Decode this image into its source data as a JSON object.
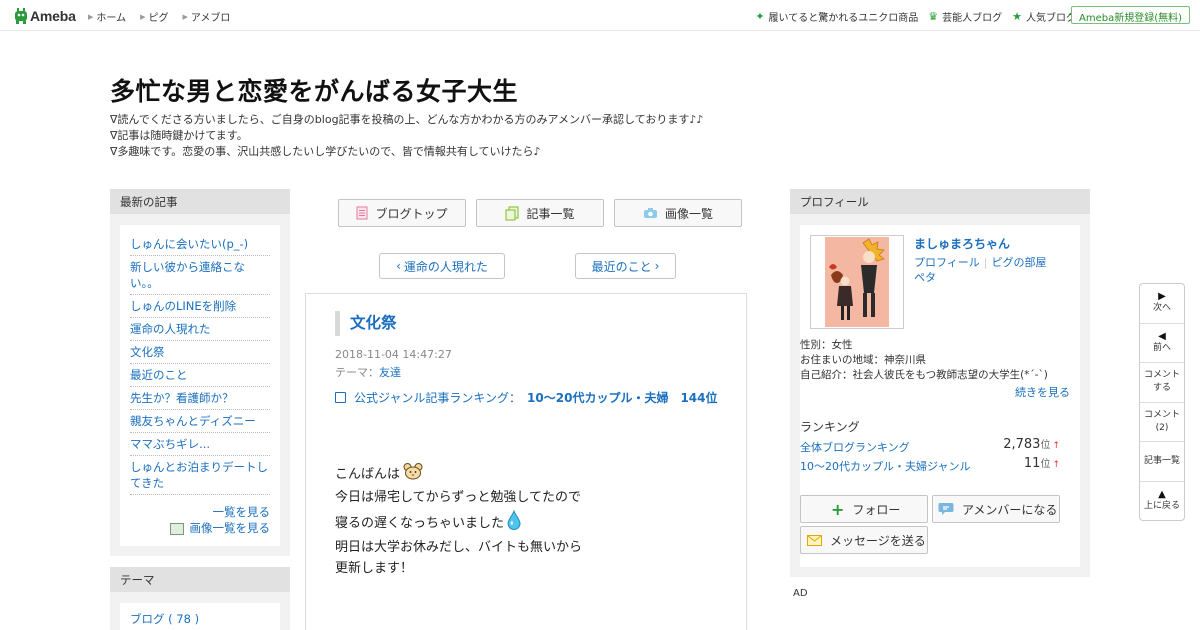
{
  "topbar": {
    "logo": "Ameba",
    "nav": [
      "ホーム",
      "ピグ",
      "アメブロ"
    ],
    "right_links": [
      {
        "icon": "sparkle-icon",
        "label": "履いてると驚かれるユニクロ商品"
      },
      {
        "icon": "crown-icon",
        "label": "芸能人ブログ"
      },
      {
        "icon": "star-icon",
        "label": "人気ブログ"
      }
    ],
    "signup": "Ameba新規登録(無料)"
  },
  "header": {
    "title": "多忙な男と恋愛をがんばる女子大生",
    "desc": [
      "∇読んでくださる方いましたら、ご自身のblog記事を投稿の上、どんな方かわかる方のみアメンバー承認しております♪♪",
      "∇記事は随時鍵かけてます。",
      "∇多趣味です。恋愛の事、沢山共感したいし学びたいので、皆で情報共有していけたら♪"
    ]
  },
  "latest": {
    "heading": "最新の記事",
    "items": [
      "しゅんに会いたい(p_-)",
      "新しい彼から連絡こない。。",
      "しゅんのLINEを削除",
      "運命の人現れた",
      "文化祭",
      "最近のこと",
      "先生か？看護師か？",
      "親友ちゃんとディズニー",
      "ママぶちギレ...",
      "しゅんとお泊まりデートしてきた"
    ],
    "more_list": "一覧を見る",
    "more_images": "画像一覧を見る"
  },
  "theme_box": {
    "heading": "テーマ",
    "items": [
      "ブログ ( 78 )"
    ]
  },
  "center_nav": {
    "blog_top": "ブログトップ",
    "article_list": "記事一覧",
    "image_list": "画像一覧",
    "prev": "運命の人現れた",
    "next": "最近のこと"
  },
  "article": {
    "title": "文化祭",
    "date": "2018-11-04 14:47:27",
    "theme_label": "テーマ：",
    "theme": "友達",
    "rank_label": "公式ジャンル記事ランキング：",
    "rank_value": "10〜20代カップル・夫婦　144位",
    "body": [
      "こんばんは",
      "今日は帰宅してからずっと勉強してたので",
      "寝るの遅くなっちゃいました",
      "明日は大学お休みだし、バイトも無いから",
      "更新します！"
    ]
  },
  "profile": {
    "heading": "プロフィール",
    "name": "ましゅまろちゃん",
    "link_profile": "プロフィール",
    "link_room": "ピグの部屋",
    "link_peta": "ペタ",
    "info": [
      "性別：女性",
      "お住まいの地域：神奈川県",
      "自己紹介：社会人彼氏をもつ教師志望の大学生(*´-`)"
    ],
    "more": "続きを見る",
    "ranking_heading": "ランキング",
    "rankings": [
      {
        "label": "全体ブログランキング",
        "value": "2,783",
        "unit": "位",
        "trend": "↑"
      },
      {
        "label": "10〜20代カップル・夫婦ジャンル",
        "value": "11",
        "unit": "位",
        "trend": "↑"
      }
    ],
    "follow": "フォロー",
    "amember": "アメンバーになる",
    "message": "メッセージを送る"
  },
  "ad_label": "AD",
  "float_nav": {
    "next": "次へ",
    "prev": "前へ",
    "comment": "コメントする",
    "comment_count": "コメント(2)",
    "list": "記事一覧",
    "top": "上に戻る"
  },
  "colors": {
    "link": "#1a6fbf",
    "brand_green": "#2a9d3a",
    "panel_bg": "#f2f2f2",
    "panel_head": "#e1e1e1"
  }
}
